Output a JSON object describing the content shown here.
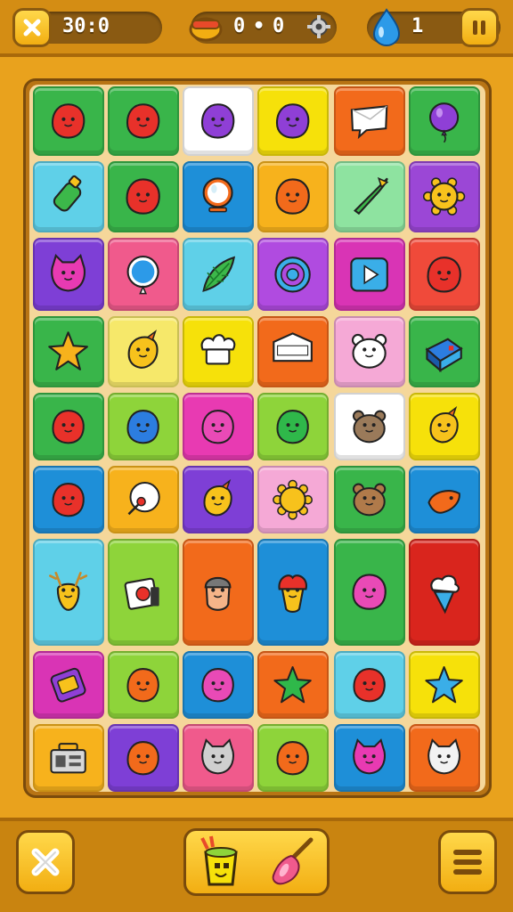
{
  "hud": {
    "score": "30:0",
    "middle_counter_left": "0",
    "middle_counter_sep": "•",
    "middle_counter_right": "0",
    "drops": "1",
    "icons": [
      "close-icon",
      "trophy-icon",
      "gear-icon",
      "droplet-icon",
      "pause-icon"
    ]
  },
  "colors": {
    "background": "#e9a21d",
    "board": "#f5d79a",
    "button": "#f7c12a"
  },
  "board": {
    "rows": [
      [
        {
          "color": "#39b54a",
          "icon": "red-blob"
        },
        {
          "color": "#39b54a",
          "icon": "red-blob"
        },
        {
          "color": "#ffffff",
          "icon": "purple-blob"
        },
        {
          "color": "#f6e10a",
          "icon": "purple-blob"
        },
        {
          "color": "#f26a1b",
          "icon": "chat-bubble"
        },
        {
          "color": "#39b54a",
          "icon": "balloon"
        }
      ],
      [
        {
          "color": "#5fd0e8",
          "icon": "green-bottle"
        },
        {
          "color": "#39b54a",
          "icon": "red-blob"
        },
        {
          "color": "#1e8fd8",
          "icon": "mirror"
        },
        {
          "color": "#f7b21c",
          "icon": "orange-blob"
        },
        {
          "color": "#8ee3a0",
          "icon": "rocket"
        },
        {
          "color": "#9b47d6",
          "icon": "sun-face"
        }
      ],
      [
        {
          "color": "#7e3fd6",
          "icon": "pink-cat"
        },
        {
          "color": "#f05a8c",
          "icon": "blue-balloon"
        },
        {
          "color": "#5fd0e8",
          "icon": "leaf"
        },
        {
          "color": "#b04be0",
          "icon": "target"
        },
        {
          "color": "#d934b5",
          "icon": "play-button"
        },
        {
          "color": "#f04a3a",
          "icon": "red-blob"
        }
      ],
      [
        {
          "color": "#39b54a",
          "icon": "star"
        },
        {
          "color": "#f6e86a",
          "icon": "yellow-bird"
        },
        {
          "color": "#f6e10a",
          "icon": "chef-hat"
        },
        {
          "color": "#f26a1b",
          "icon": "sign"
        },
        {
          "color": "#f5a9d6",
          "icon": "polar-bear"
        },
        {
          "color": "#39b54a",
          "icon": "blue-box"
        }
      ],
      [
        {
          "color": "#39b54a",
          "icon": "red-blob"
        },
        {
          "color": "#8ed43a",
          "icon": "blue-blob"
        },
        {
          "color": "#e83ab2",
          "icon": "pink-blob"
        },
        {
          "color": "#8ed43a",
          "icon": "green-blob"
        },
        {
          "color": "#ffffff",
          "icon": "bear"
        },
        {
          "color": "#f6e10a",
          "icon": "yellow-bird"
        }
      ],
      [
        {
          "color": "#1e8fd8",
          "icon": "red-blob"
        },
        {
          "color": "#f7b21c",
          "icon": "pin"
        },
        {
          "color": "#7e3fd6",
          "icon": "yellow-bird"
        },
        {
          "color": "#f5a9d6",
          "icon": "sun"
        },
        {
          "color": "#39b54a",
          "icon": "brown-bear"
        },
        {
          "color": "#1e8fd8",
          "icon": "orange-fish"
        }
      ],
      [
        {
          "color": "#5fd0e8",
          "icon": "deer"
        },
        {
          "color": "#8ed43a",
          "icon": "camera"
        },
        {
          "color": "#f26a1b",
          "icon": "face"
        },
        {
          "color": "#1e8fd8",
          "icon": "flame-face"
        },
        {
          "color": "#39b54a",
          "icon": "pink-blob"
        },
        {
          "color": "#d9251d",
          "icon": "ice-cream"
        }
      ],
      [
        {
          "color": "#d934b5",
          "icon": "phone-card"
        },
        {
          "color": "#8ed43a",
          "icon": "orange-blob"
        },
        {
          "color": "#1e8fd8",
          "icon": "pink-blob"
        },
        {
          "color": "#f26a1b",
          "icon": "green-star"
        },
        {
          "color": "#5fd0e8",
          "icon": "red-blob"
        },
        {
          "color": "#f6e10a",
          "icon": "blue-star"
        }
      ],
      [
        {
          "color": "#f7b21c",
          "icon": "radio"
        },
        {
          "color": "#7e3fd6",
          "icon": "orange-blob"
        },
        {
          "color": "#f05a8c",
          "icon": "grey-cat"
        },
        {
          "color": "#8ed43a",
          "icon": "orange-blob"
        },
        {
          "color": "#1e8fd8",
          "icon": "pink-cat"
        },
        {
          "color": "#f26a1b",
          "icon": "white-cat"
        }
      ]
    ]
  },
  "bottom": {
    "icons": [
      "close-icon",
      "paint-bucket-icon",
      "brush-icon",
      "menu-icon"
    ]
  }
}
